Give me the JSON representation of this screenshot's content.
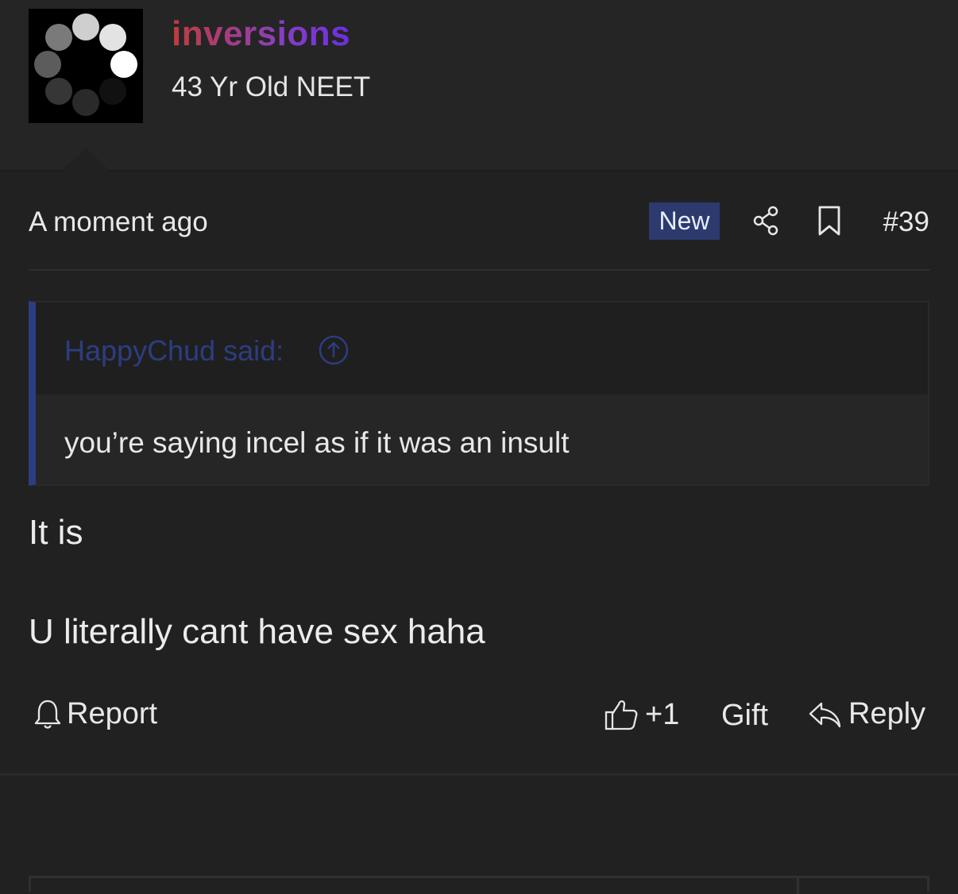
{
  "user": {
    "username": "inversions",
    "title": "43 Yr Old NEET",
    "username_gradient": [
      "#c23b3b",
      "#8a3fbf",
      "#6a2fe0"
    ],
    "avatar_icon": "loading-spinner-dots"
  },
  "post": {
    "time": "A moment ago",
    "badge": "New",
    "number": "#39",
    "icons": [
      "share-icon",
      "bookmark-icon"
    ]
  },
  "quote": {
    "author": "HappyChud said:",
    "text": "you’re saying incel as if it was an insult",
    "accent": "#2e3d82"
  },
  "body": {
    "line1": "It is",
    "line2": "U literally cant have sex haha"
  },
  "actions": {
    "report": "Report",
    "like": "+1",
    "gift": "Gift",
    "reply": "Reply"
  },
  "colors": {
    "background": "#212121",
    "badge": "#2c3a6e"
  }
}
